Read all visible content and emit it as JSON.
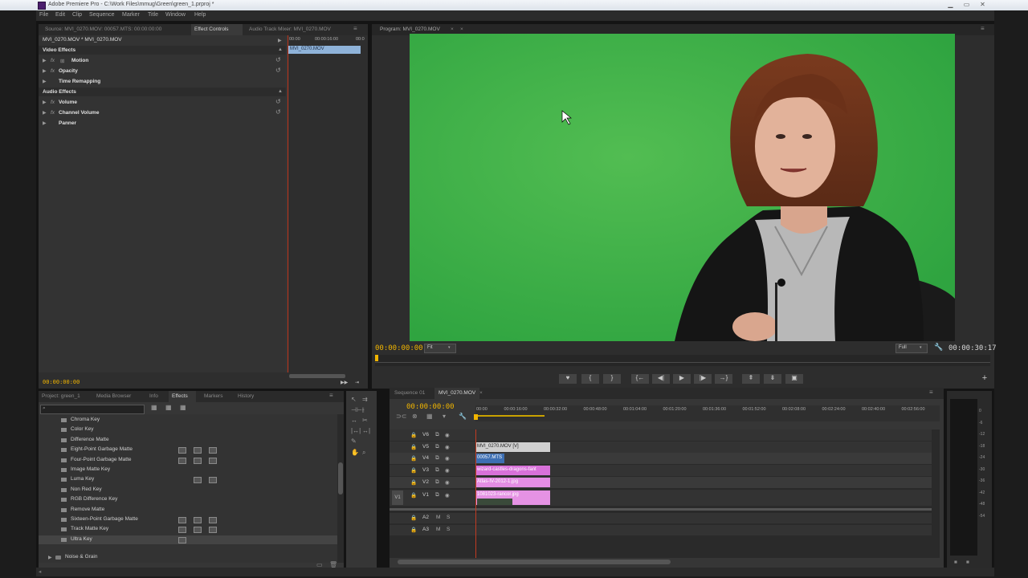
{
  "window": {
    "title": "Adobe Premiere Pro - C:\\Work Files\\mmug\\Green\\green_1.prproj *"
  },
  "menu": [
    "File",
    "Edit",
    "Clip",
    "Sequence",
    "Marker",
    "Title",
    "Window",
    "Help"
  ],
  "source_panel": {
    "tabs": [
      "Source: MVI_0270.MOV: 00057.MTS: 00:00:00:00",
      "Effect Controls",
      "Audio Track Mixer: MVI_0270.MOV"
    ],
    "clip_header": "MVI_0270.MOV * MVI_0270.MOV",
    "video_effects_label": "Video Effects",
    "audio_effects_label": "Audio Effects",
    "video_effects": [
      "Motion",
      "Opacity",
      "Time Remapping"
    ],
    "audio_effects": [
      "Volume",
      "Channel Volume",
      "Panner"
    ],
    "mini_ruler": [
      "00:00",
      "00:00:16:00",
      "00:0"
    ],
    "mini_clip": "MVI_0270.MOV",
    "timecode": "00:00:00:00"
  },
  "program_panel": {
    "tab": "Program: MVI_0270.MOV",
    "timecode_left": "00:00:00:00",
    "fit": "Fit",
    "resolution": "Full",
    "timecode_right": "00:00:30:17"
  },
  "effects_panel": {
    "tabs": [
      "Project: green_1",
      "Media Browser",
      "Info",
      "Effects",
      "Markers",
      "History"
    ],
    "search_placeholder": "",
    "items": [
      "Chroma Key",
      "Color Key",
      "Difference Matte",
      "Eight-Point Garbage Matte",
      "Four-Point Garbage Matte",
      "Image Matte Key",
      "Luma Key",
      "Non Red Key",
      "RGB Difference Key",
      "Remove Matte",
      "Sixteen-Point Garbage Matte",
      "Track Matte Key",
      "Ultra Key"
    ],
    "folder_noise": "Noise & Grain"
  },
  "timeline": {
    "tabs": [
      "Sequence 01",
      "MVI_0270.MOV"
    ],
    "timecode": "00:00:00:00",
    "ruler": [
      "00:00",
      "00:00:16:00",
      "00:00:32:00",
      "00:00:48:00",
      "00:01:04:00",
      "00:01:20:00",
      "00:01:36:00",
      "00:01:52:00",
      "00:02:08:00",
      "00:02:24:00",
      "00:02:40:00",
      "00:02:56:00"
    ],
    "video_tracks": [
      "V6",
      "V5",
      "V4",
      "V3",
      "V2",
      "V1"
    ],
    "source_patch": "V1",
    "audio_tracks": [
      "A2",
      "A3"
    ],
    "clips": {
      "v5": "MVI_0270.MOV [V]",
      "v4": "00057.MTS",
      "v3": "wizard-castles-dragons-fant",
      "v2": "Atlas-IV-2012-1.jpg",
      "v1": "1081023-rancor.jpg"
    },
    "clip_colors": {
      "v5": "#cfcfcf",
      "v4": "#3d6fb3",
      "v3": "#d871d9",
      "v2": "#e48de4",
      "v1": "#e592e4"
    }
  },
  "audio_meter": {
    "scale": [
      "0",
      "-6",
      "-12",
      "-18",
      "-24",
      "-30",
      "-36",
      "-42",
      "-48",
      "-54"
    ]
  }
}
